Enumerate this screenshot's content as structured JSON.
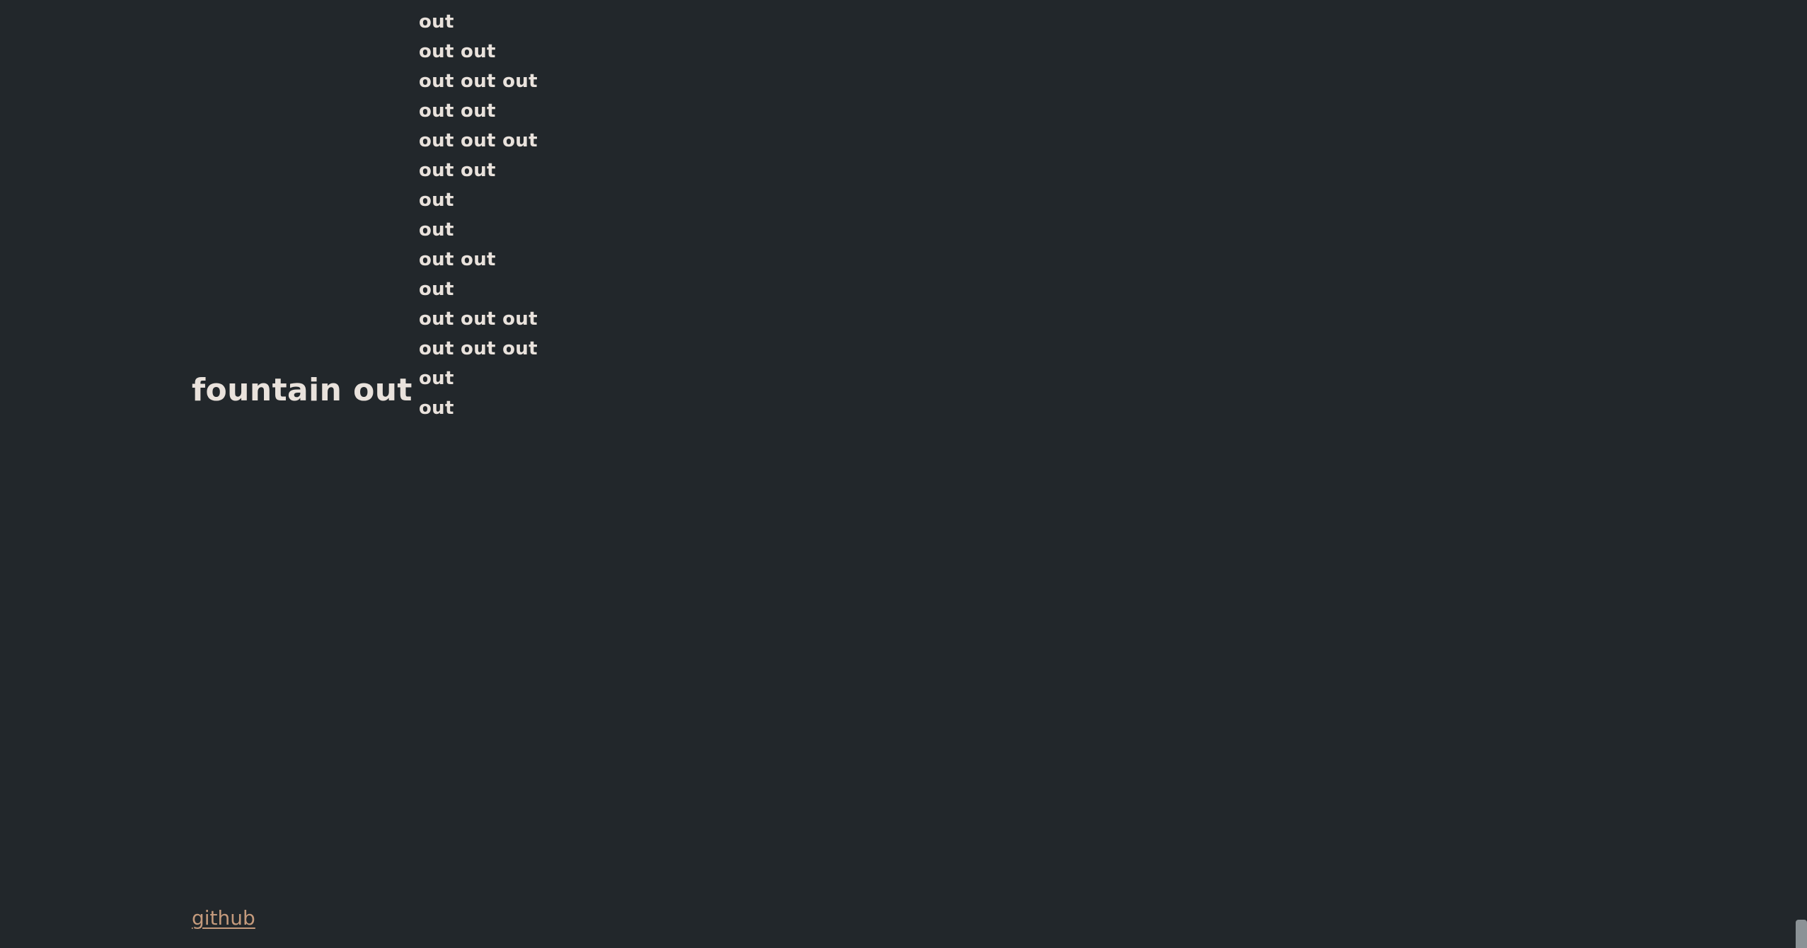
{
  "page": {
    "title": "fountain out",
    "background_color": "#22272b",
    "text_color": "#e9e2dc",
    "link_color": "#c49a7c",
    "scrollbar_color": "#8b9296"
  },
  "main": {
    "label": "fountain out"
  },
  "echo": {
    "lines": [
      "out",
      "out out",
      "out out out",
      "out out",
      "out out out",
      "out out",
      "out",
      "out",
      "out out",
      "out",
      "out out out",
      "out out out",
      "out",
      "out"
    ]
  },
  "footer": {
    "github_label": "github"
  }
}
